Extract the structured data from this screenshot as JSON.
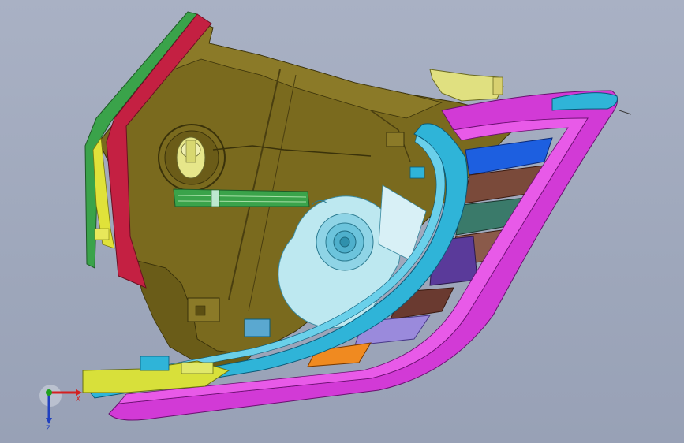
{
  "viewport": {
    "colors": {
      "background_top": "#a9b1c4",
      "background_bottom": "#98a1b6",
      "housing": "#7a6a1e",
      "housing_dark": "#5c4f12",
      "bezel_cyan": "#2fb4d8",
      "bezel_magenta": "#d23ad6",
      "green_lens": "#3aa34a",
      "red_trim": "#c42042",
      "yellow_trim": "#e0e23a",
      "light_cyan": "#bde8f0",
      "blue_reflector": "#1d5fe0",
      "brown_reflector": "#7a4a3a",
      "teal_reflector": "#3a7a6a",
      "purple_reflector": "#5a3a9a",
      "orange_reflector": "#f08a20",
      "lavender_reflector": "#9a8adc"
    }
  },
  "triad": {
    "x_label": "X",
    "z_label": "Z",
    "colors": {
      "x": "#d42020",
      "y": "#20a020",
      "z": "#2040c0"
    }
  }
}
